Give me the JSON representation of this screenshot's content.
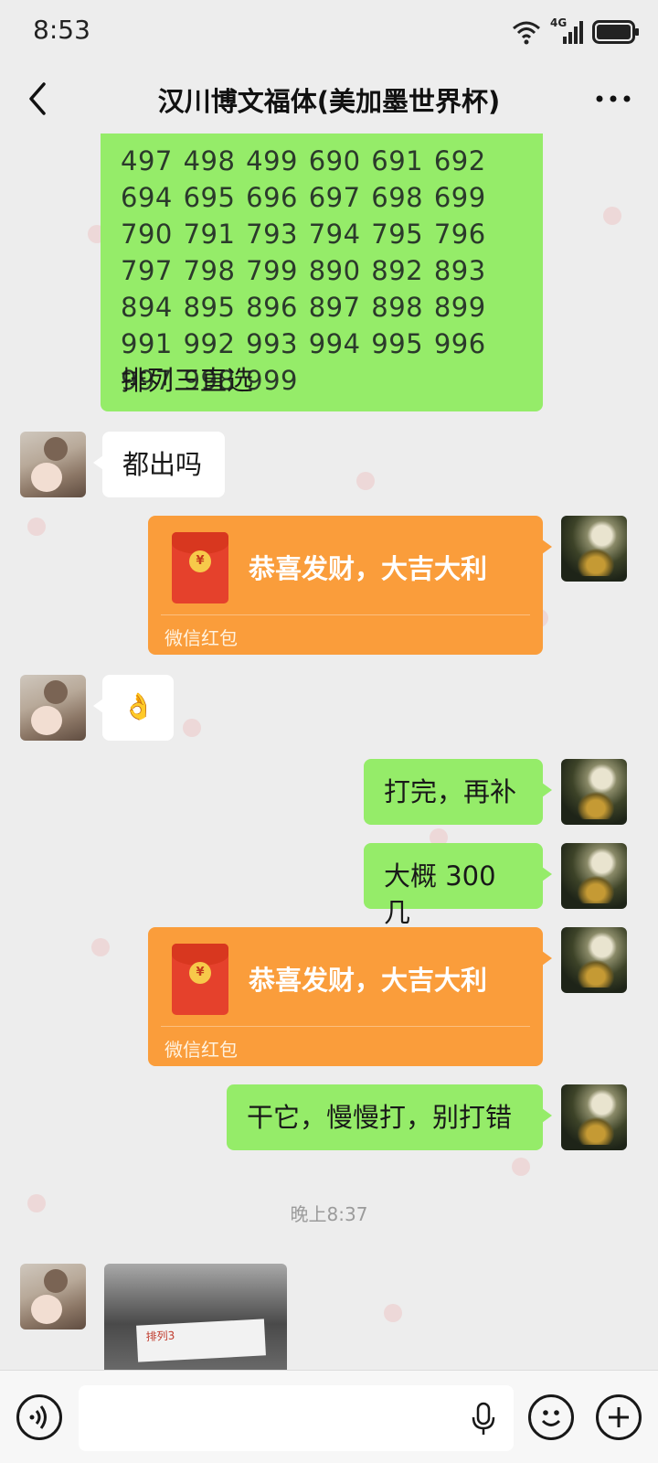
{
  "status_bar": {
    "time": "8:53",
    "network": "4G"
  },
  "header": {
    "title": "汉川博文福体(美加墨世界杯)",
    "back_icon": "back-arrow-icon",
    "more_icon": "more-dots-icon"
  },
  "messages": [
    {
      "side": "right",
      "type": "text",
      "numbers": "497 498 499 690 691 692 694 695 696 697 698 699 790 791 793 794 795 796 797 798 799 890 892 893 894 895 896 897 898 899 991 992 993 994 995 996 997 998 999",
      "suffix": "排列三直选"
    },
    {
      "side": "left",
      "type": "text",
      "text": "都出吗"
    },
    {
      "side": "right",
      "type": "red_packet",
      "title": "恭喜发财，大吉大利",
      "label": "微信红包"
    },
    {
      "side": "left",
      "type": "emoji",
      "text": "👌"
    },
    {
      "side": "right",
      "type": "text",
      "text": "打完，再补"
    },
    {
      "side": "right",
      "type": "text",
      "text": "大概 300 几"
    },
    {
      "side": "right",
      "type": "red_packet",
      "title": "恭喜发财，大吉大利",
      "label": "微信红包"
    },
    {
      "side": "right",
      "type": "text",
      "text": "干它，慢慢打，别打错"
    },
    {
      "type": "timestamp",
      "text": "晚上8:37"
    },
    {
      "side": "left",
      "type": "image",
      "photo_text": "排列3"
    }
  ],
  "input_bar": {
    "voice_icon": "voice-toggle-icon",
    "mic_icon": "microphone-icon",
    "emoji_icon": "emoji-icon",
    "plus_icon": "plus-icon"
  },
  "colors": {
    "self_bubble": "#95ec69",
    "other_bubble": "#ffffff",
    "red_packet": "#fa9d3b",
    "background": "#ededed"
  }
}
